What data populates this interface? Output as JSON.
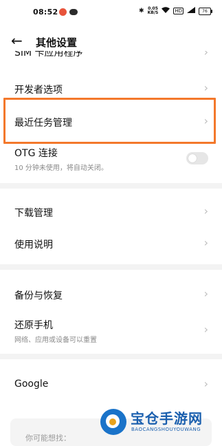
{
  "status_bar": {
    "time": "08:52",
    "net_speed_value": "0.05",
    "net_speed_unit": "KB/S",
    "hd_label": "HD",
    "battery": "76",
    "network_label": "4G"
  },
  "header": {
    "title": "其他设置"
  },
  "items": {
    "sim_apps": "SIM 卡应用程序",
    "developer": "开发者选项",
    "recent_tasks": "最近任务管理",
    "otg": "OTG 连接",
    "otg_sub": "10 分钟未使用，将自动关闭。",
    "download": "下载管理",
    "instructions": "使用说明",
    "backup": "备份与恢复",
    "reset": "还原手机",
    "reset_sub": "网络、应用或设备可以重置",
    "google": "Google"
  },
  "bottom_card": {
    "label": "你可能想找："
  },
  "watermark": {
    "title": "宝仓手游网",
    "subtitle": "BAOCANGSHOUYOUWANG"
  },
  "colors": {
    "highlight": "#f3782b",
    "brand": "#1a5fae"
  }
}
